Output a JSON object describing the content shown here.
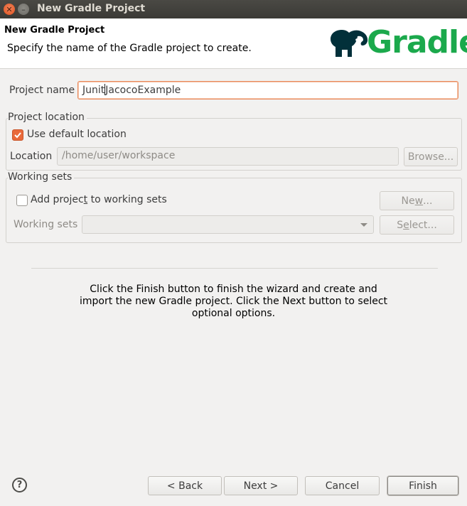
{
  "window": {
    "title": "New Gradle Project"
  },
  "header": {
    "title": "New Gradle Project",
    "description": "Specify the name of the Gradle project to create.",
    "logo_text": "Gradle",
    "logo_color": "#1ba94c"
  },
  "project_name": {
    "label": "Project name",
    "value": "JunitJacocoExample"
  },
  "project_location": {
    "group_title": "Project location",
    "use_default_label": "Use default location",
    "use_default_checked": true,
    "location_label": "Location",
    "location_value": "/home/user/workspace",
    "browse_label": "Browse..."
  },
  "working_sets": {
    "group_title": "Working sets",
    "add_label_pre": "Add projec",
    "add_label_mnemonic": "t",
    "add_label_post": " to working sets",
    "add_checked": false,
    "new_label_pre": "Ne",
    "new_label_mnemonic": "w",
    "new_label_post": "...",
    "combo_label": "Working sets",
    "combo_value": "",
    "select_label_pre": "S",
    "select_label_mnemonic": "e",
    "select_label_post": "lect..."
  },
  "info_text": "Click the Finish button to finish the wizard and create and import the new Gradle project. Click the Next button to select optional options.",
  "footer": {
    "help_icon": "?",
    "back_label": "< Back",
    "next_label": "Next >",
    "cancel_label": "Cancel",
    "finish_label": "Finish"
  },
  "colors": {
    "accent": "#e96a3b",
    "brand": "#1ba94c",
    "titlebar": "#3b3a36"
  }
}
